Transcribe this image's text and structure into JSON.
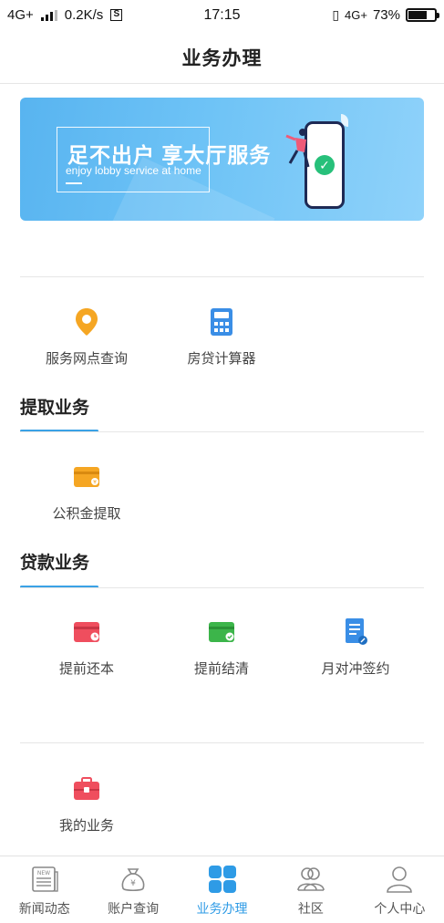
{
  "status": {
    "network": "4G+",
    "speed": "0.2K/s",
    "s_badge": "S",
    "time": "17:15",
    "network_right": "4G+",
    "battery": "73%",
    "battery_level": 0.73
  },
  "header": {
    "title": "业务办理"
  },
  "banner": {
    "headline": "足不出户 享大厅服务",
    "subtitle": "enjoy lobby service at home"
  },
  "quick_services": [
    {
      "label": "服务网点查询",
      "icon": "location-pin-icon",
      "color": "#f5a623"
    },
    {
      "label": "房贷计算器",
      "icon": "calculator-icon",
      "color": "#3a8ee6"
    }
  ],
  "sections": [
    {
      "title": "提取业务",
      "items": [
        {
          "label": "公积金提取",
          "icon": "wallet-icon",
          "color": "#f5a623"
        }
      ]
    },
    {
      "title": "贷款业务",
      "items": [
        {
          "label": "提前还本",
          "icon": "card-clock-icon",
          "color": "#ef4e5e"
        },
        {
          "label": "提前结清",
          "icon": "card-check-icon",
          "color": "#3cb54a"
        },
        {
          "label": "月对冲签约",
          "icon": "document-sign-icon",
          "color": "#3a8ee6"
        }
      ]
    }
  ],
  "my_business": {
    "label": "我的业务",
    "icon": "briefcase-icon",
    "color": "#ef4e5e"
  },
  "tabs": [
    {
      "label": "新闻动态",
      "icon": "news-icon",
      "active": false
    },
    {
      "label": "账户查询",
      "icon": "money-bag-icon",
      "active": false
    },
    {
      "label": "业务办理",
      "icon": "grid-icon",
      "active": true
    },
    {
      "label": "社区",
      "icon": "community-icon",
      "active": false
    },
    {
      "label": "个人中心",
      "icon": "person-icon",
      "active": false
    }
  ],
  "colors": {
    "accent": "#2e9be6",
    "underline": "#3aa2e6"
  }
}
